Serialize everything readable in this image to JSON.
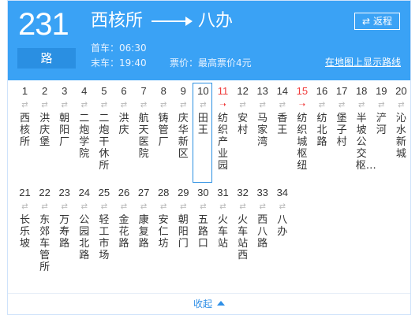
{
  "route": {
    "number": "231",
    "unit": "路"
  },
  "title": {
    "from": "西核所",
    "to": "八办"
  },
  "first_bus": "首车：06:30",
  "last_bus": "末车：19:40",
  "fare": "票价：最高票价4元",
  "return_button": {
    "icon": "swap-arrows-icon",
    "label": "返程"
  },
  "map_link": "在地图上显示路线",
  "stops_row1": [
    {
      "num": "1",
      "name": "西核所",
      "color": "normal"
    },
    {
      "num": "2",
      "name": "洪庆堡",
      "color": "normal"
    },
    {
      "num": "3",
      "name": "朝阳厂",
      "color": "normal"
    },
    {
      "num": "4",
      "name": "二炮学院",
      "color": "normal"
    },
    {
      "num": "5",
      "name": "二炮干休所",
      "color": "normal"
    },
    {
      "num": "6",
      "name": "洪庆",
      "color": "normal"
    },
    {
      "num": "7",
      "name": "航天医院",
      "color": "normal"
    },
    {
      "num": "8",
      "name": "铸管厂",
      "color": "normal"
    },
    {
      "num": "9",
      "name": "庆华新区",
      "color": "normal"
    },
    {
      "num": "10",
      "name": "田王",
      "color": "normal"
    },
    {
      "num": "11",
      "name": "纺织产业园",
      "color": "red"
    },
    {
      "num": "12",
      "name": "安村",
      "color": "normal"
    },
    {
      "num": "13",
      "name": "马家湾",
      "color": "normal"
    },
    {
      "num": "14",
      "name": "香王",
      "color": "normal"
    },
    {
      "num": "15",
      "name": "纺织城枢纽",
      "color": "red"
    },
    {
      "num": "16",
      "name": "纺北路",
      "color": "normal"
    },
    {
      "num": "17",
      "name": "堡子村",
      "color": "normal"
    },
    {
      "num": "18",
      "name": "半坡公交枢…",
      "color": "normal"
    },
    {
      "num": "19",
      "name": "浐河",
      "color": "normal"
    },
    {
      "num": "20",
      "name": "沁水新城",
      "color": "normal"
    }
  ],
  "stops_row2": [
    {
      "num": "21",
      "name": "长乐坡",
      "color": "normal"
    },
    {
      "num": "22",
      "name": "东郊车管所",
      "color": "normal"
    },
    {
      "num": "23",
      "name": "万寿路",
      "color": "normal"
    },
    {
      "num": "24",
      "name": "公园北路",
      "color": "normal"
    },
    {
      "num": "25",
      "name": "轻工市场",
      "color": "normal"
    },
    {
      "num": "26",
      "name": "金花路",
      "color": "normal"
    },
    {
      "num": "27",
      "name": "康复路",
      "color": "normal"
    },
    {
      "num": "28",
      "name": "安仁坊",
      "color": "normal"
    },
    {
      "num": "29",
      "name": "朝阳门",
      "color": "normal"
    },
    {
      "num": "30",
      "name": "五路口",
      "color": "normal"
    },
    {
      "num": "31",
      "name": "火车站",
      "color": "normal"
    },
    {
      "num": "32",
      "name": "火车站西",
      "color": "normal"
    },
    {
      "num": "33",
      "name": "西八路",
      "color": "normal"
    },
    {
      "num": "34",
      "name": "八办",
      "color": "normal"
    }
  ],
  "selected_stop": "10",
  "collapse_label": "收起",
  "colors": {
    "header": "#3aa2f5",
    "accent": "#2a8fe2",
    "alert": "#ef3b3b",
    "link": "#2f8fe6"
  }
}
